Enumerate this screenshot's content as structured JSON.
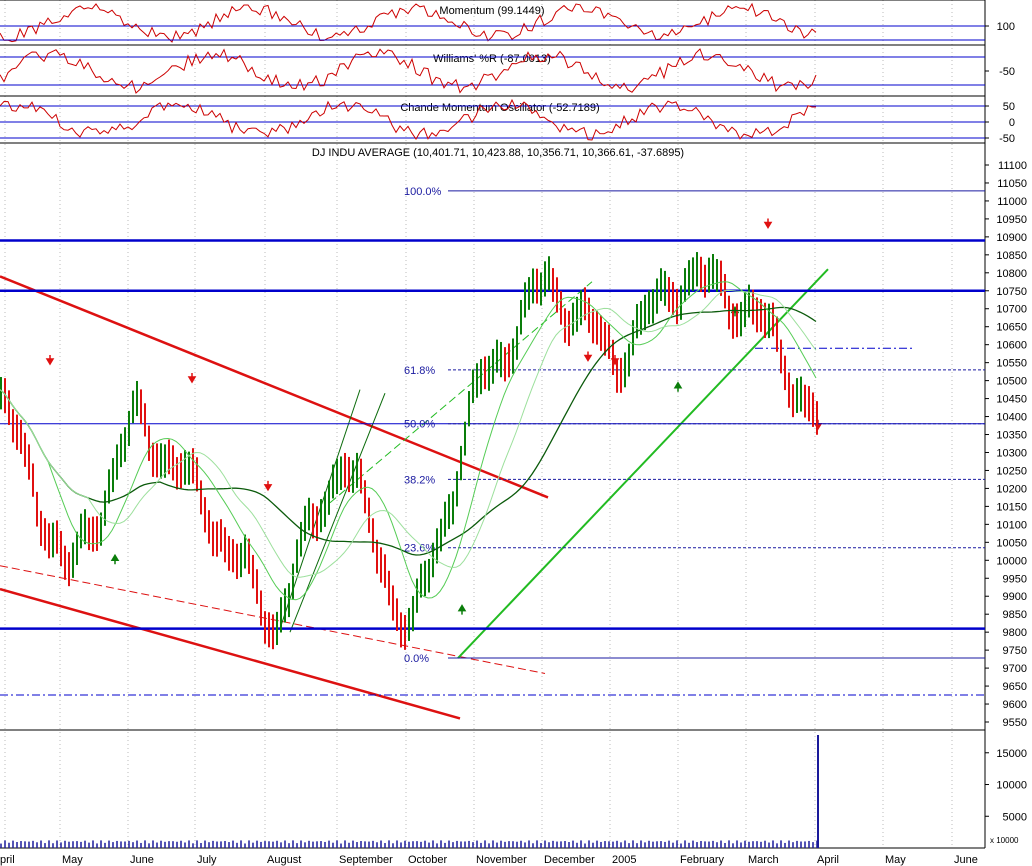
{
  "panels": {
    "momentum": {
      "title": "Momentum (99.1449)",
      "ticks": [
        {
          "v": 100,
          "label": "100"
        }
      ]
    },
    "williams": {
      "title": "Williams' %R (-87.0013)",
      "ticks": [
        {
          "v": -50,
          "label": "-50"
        }
      ]
    },
    "chande": {
      "title": "Chande Momentum Oscillator (-52.7189)",
      "ticks": [
        {
          "v": 50,
          "label": "50"
        },
        {
          "v": 0,
          "label": "0"
        },
        {
          "v": -50,
          "label": "-50"
        }
      ]
    },
    "price": {
      "title": "DJ INDU AVERAGE (10,401.71, 10,423.88, 10,356.71, 10,366.61, -37.6895)"
    },
    "volume": {
      "title": "",
      "unit_label": "x 10000",
      "ticks": [
        {
          "v": 15000,
          "label": "15000"
        },
        {
          "v": 10000,
          "label": "10000"
        },
        {
          "v": 5000,
          "label": "5000"
        }
      ]
    }
  },
  "x_axis": {
    "labels": [
      "pril",
      "May",
      "June",
      "July",
      "August",
      "September",
      "October",
      "November",
      "December",
      "2005",
      "February",
      "March",
      "April",
      "May",
      "June"
    ]
  },
  "colors": {
    "up_bar": "#0a7d0a",
    "down_bar": "#e01010",
    "support_line": "#0000cc",
    "trend_red": "#dd1111",
    "trend_green": "#22bb22",
    "ma_dark": "#0b5a0b",
    "ma_light": "#55cc55",
    "indicator": "#cc0000",
    "fib_text": "#1a1aa0"
  },
  "chart_data": {
    "type": "line",
    "title": "DJ INDU AVERAGE (10,401.71, 10,423.88, 10,356.71, 10,366.61, -37.6895)",
    "y_axis": {
      "range": [
        9500,
        11150
      ],
      "ticks": [
        9550,
        9600,
        9650,
        9700,
        9750,
        9800,
        9850,
        9900,
        9950,
        10000,
        10050,
        10100,
        10150,
        10200,
        10250,
        10300,
        10350,
        10400,
        10450,
        10500,
        10550,
        10600,
        10650,
        10700,
        10750,
        10800,
        10850,
        10900,
        10950,
        11000,
        11050,
        11100
      ]
    },
    "x_axis": {
      "months": [
        "pril",
        "May",
        "June",
        "July",
        "August",
        "September",
        "October",
        "November",
        "December",
        "2005",
        "February",
        "March",
        "April",
        "May",
        "June"
      ]
    },
    "last_bar": {
      "open": 10401.71,
      "high": 10423.88,
      "low": 10356.71,
      "close": 10366.61,
      "change": -37.6895
    },
    "approx_weekly_closes": [
      {
        "month": "pril",
        "close": 10450
      },
      {
        "month": "May",
        "close": 9950
      },
      {
        "month": "June",
        "close": 10400
      },
      {
        "month": "July",
        "close": 10150
      },
      {
        "month": "August",
        "close": 9820
      },
      {
        "month": "September",
        "close": 10300
      },
      {
        "month": "October",
        "close": 9780
      },
      {
        "month": "November",
        "close": 10480
      },
      {
        "month": "December",
        "close": 10780
      },
      {
        "month": "2005",
        "close": 10560
      },
      {
        "month": "February",
        "close": 10800
      },
      {
        "month": "March",
        "close": 10700
      },
      {
        "month": "April",
        "close": 10380
      }
    ],
    "horizontal_lines": [
      {
        "value": 10890,
        "style": "solid-thick"
      },
      {
        "value": 10750,
        "style": "solid-thick"
      },
      {
        "value": 10380,
        "style": "solid"
      },
      {
        "value": 9810,
        "style": "solid-thick"
      },
      {
        "value": 9625,
        "style": "dash-dot"
      },
      {
        "value": 10590,
        "style": "dash-dot"
      }
    ],
    "fibonacci": [
      {
        "label": "100.0%",
        "value": 11028
      },
      {
        "label": "61.8%",
        "value": 10530
      },
      {
        "label": "50.0%",
        "value": 10380
      },
      {
        "label": "38.2%",
        "value": 10225
      },
      {
        "label": "23.6%",
        "value": 10035
      },
      {
        "label": "0.0%",
        "value": 9728
      }
    ],
    "indicators": [
      {
        "name": "Momentum",
        "value": 99.1449
      },
      {
        "name": "Williams' %R",
        "value": -87.0013
      },
      {
        "name": "Chande Momentum Oscillator",
        "value": -52.7189
      }
    ],
    "volume_last": 17800,
    "grid": true
  }
}
